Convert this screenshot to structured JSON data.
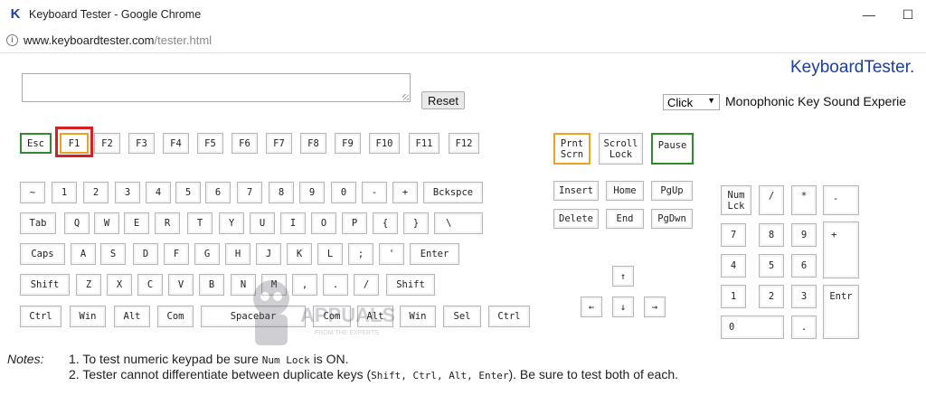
{
  "window": {
    "app_icon": "K",
    "title": "Keyboard Tester - Google Chrome",
    "minimize": "—",
    "maximize": "☐"
  },
  "address_bar": {
    "host": "www.keyboardtester.com",
    "path": "/tester.html"
  },
  "brand": "KeyboardTester.",
  "reset_label": "Reset",
  "sound_select": {
    "value": "Click",
    "label": "Monophonic Key Sound Experie"
  },
  "keys": {
    "esc": "Esc",
    "f1": "F1",
    "f2": "F2",
    "f3": "F3",
    "f4": "F4",
    "f5": "F5",
    "f6": "F6",
    "f7": "F7",
    "f8": "F8",
    "f9": "F9",
    "f10": "F10",
    "f11": "F11",
    "f12": "F12",
    "prntscrn": "Prnt\nScrn",
    "scrolllock": "Scroll\nLock",
    "pause": "Pause",
    "tilde": "~",
    "k1": "1",
    "k2": "2",
    "k3": "3",
    "k4": "4",
    "k5": "5",
    "k6": "6",
    "k7": "7",
    "k8": "8",
    "k9": "9",
    "k0": "0",
    "minus": "-",
    "plus": "+",
    "backspace": "Bckspce",
    "tab": "Tab",
    "q": "Q",
    "w": "W",
    "e": "E",
    "r": "R",
    "t": "T",
    "y": "Y",
    "u": "U",
    "i": "I",
    "o": "O",
    "p": "P",
    "lbrace": "{",
    "rbrace": "}",
    "backslash": "\\",
    "caps": "Caps",
    "a": "A",
    "s": "S",
    "d": "D",
    "f": "F",
    "g": "G",
    "h": "H",
    "j": "J",
    "k": "K",
    "l": "L",
    "semicolon": ";",
    "quote": "'",
    "enter": "Enter",
    "lshift": "Shift",
    "z": "Z",
    "x": "X",
    "c": "C",
    "v": "V",
    "b": "B",
    "n": "N",
    "m": "M",
    "comma": ",",
    "period": ".",
    "slash": "/",
    "rshift": "Shift",
    "lctrl": "Ctrl",
    "lwin": "Win",
    "lalt": "Alt",
    "lcom": "Com",
    "spacebar": "Spacebar",
    "rcom": "Com",
    "ralt": "Alt",
    "rwin": "Win",
    "sel": "Sel",
    "rctrl": "Ctrl",
    "insert": "Insert",
    "home": "Home",
    "pgup": "PgUp",
    "delete": "Delete",
    "end": "End",
    "pgdwn": "PgDwn",
    "up": "↑",
    "left": "←",
    "down": "↓",
    "right": "→",
    "numlock": "Num\nLck",
    "numslash": "/",
    "numstar": "*",
    "numminus": "-",
    "num7": "7",
    "num8": "8",
    "num9": "9",
    "numplus": "+",
    "num4": "4",
    "num5": "5",
    "num6": "6",
    "num1": "1",
    "num2": "2",
    "num3": "3",
    "numenter": "Entr",
    "num0": "0",
    "numdot": "."
  },
  "notes": {
    "label": "Notes:",
    "line1": {
      "prefix": "1. To test numeric keypad be sure ",
      "code": "Num Lock",
      "suffix": " is ON."
    },
    "line2": {
      "prefix": "2. Tester cannot differentiate between duplicate keys (",
      "code": "Shift, Ctrl, Alt, Enter",
      "suffix": "). Be sure to test both of each."
    }
  },
  "watermark": {
    "name": "APPUALS",
    "tagline": "FROM THE EXPERTS"
  },
  "colors": {
    "pressed_green": "#2e8b2e",
    "pressed_orange": "#f0a020",
    "highlight_red": "#d42020",
    "brand_blue": "#1c3f9c"
  }
}
